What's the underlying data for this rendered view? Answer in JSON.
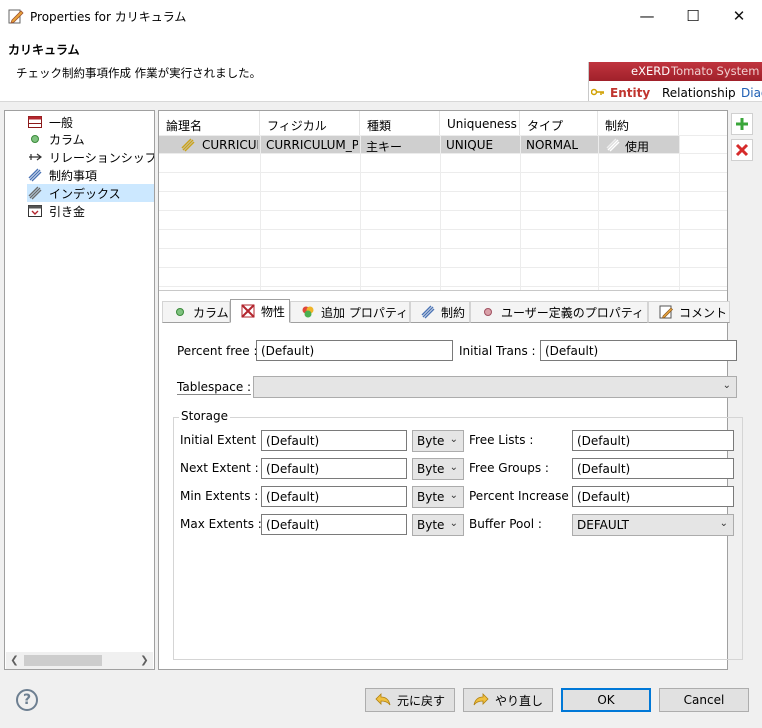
{
  "window": {
    "title": "Properties for カリキュラム",
    "minimize": "—",
    "maximize": "☐",
    "close": "✕"
  },
  "header": {
    "title": "カリキュラム",
    "message": "チェック制約事項作成 作業が実行されました。",
    "banner": {
      "brand": "eXERD",
      "product": "Tomato System",
      "tab_entity": "Entity",
      "tab_relationship": "Relationship",
      "tab_diagram": "Diag"
    }
  },
  "tree": {
    "items": [
      {
        "label": "一般",
        "icon": "table-icon"
      },
      {
        "label": "カラム",
        "icon": "column-dot-icon"
      },
      {
        "label": "リレーションシップ",
        "icon": "relationship-icon"
      },
      {
        "label": "制約事項",
        "icon": "constraint-icon"
      },
      {
        "label": "インデックス",
        "icon": "index-icon",
        "selected": true
      },
      {
        "label": "引き金",
        "icon": "trigger-icon"
      }
    ]
  },
  "grid": {
    "headers": [
      "論理名",
      "フィジカル",
      "種類",
      "Uniqueness",
      "タイプ",
      "制約"
    ],
    "rows": [
      {
        "logical": "CURRICULUM_PK",
        "physical": "CURRICULUM_PK",
        "kind": "主キー",
        "uniqueness": "UNIQUE",
        "type": "NORMAL",
        "constraint": "使用"
      }
    ]
  },
  "tabs": [
    {
      "label": "カラム",
      "icon": "column-dot-icon"
    },
    {
      "label": "物性",
      "icon": "physical-icon",
      "active": true
    },
    {
      "label": "追加 プロパティ",
      "icon": "extra-props-icon"
    },
    {
      "label": "制約",
      "icon": "constraint-icon"
    },
    {
      "label": "ユーザー定義のプロパティ",
      "icon": "user-prop-icon"
    },
    {
      "label": "コメント",
      "icon": "comment-icon"
    }
  ],
  "form": {
    "percent_free_label": "Percent free :",
    "percent_free": "(Default)",
    "initial_trans_label": "Initial Trans :",
    "initial_trans": "(Default)",
    "tablespace_label": "Tablespace :",
    "tablespace": "",
    "storage_label": "Storage",
    "initial_extent_label": "Initial Extent :",
    "initial_extent": "(Default)",
    "initial_extent_unit": "Byte",
    "next_extent_label": "Next Extent :",
    "next_extent": "(Default)",
    "next_extent_unit": "Byte",
    "min_extents_label": "Min Extents :",
    "min_extents": "(Default)",
    "min_extents_unit": "Byte",
    "max_extents_label": "Max Extents :",
    "max_extents": "(Default)",
    "max_extents_unit": "Byte",
    "free_lists_label": "Free Lists :",
    "free_lists": "(Default)",
    "free_groups_label": "Free Groups :",
    "free_groups": "(Default)",
    "percent_increase_label": "Percent Increase :",
    "percent_increase": "(Default)",
    "buffer_pool_label": "Buffer Pool :",
    "buffer_pool": "DEFAULT"
  },
  "buttons": {
    "restore": "元に戻す",
    "redo": "やり直し",
    "ok": "OK",
    "cancel": "Cancel",
    "help": "?"
  }
}
